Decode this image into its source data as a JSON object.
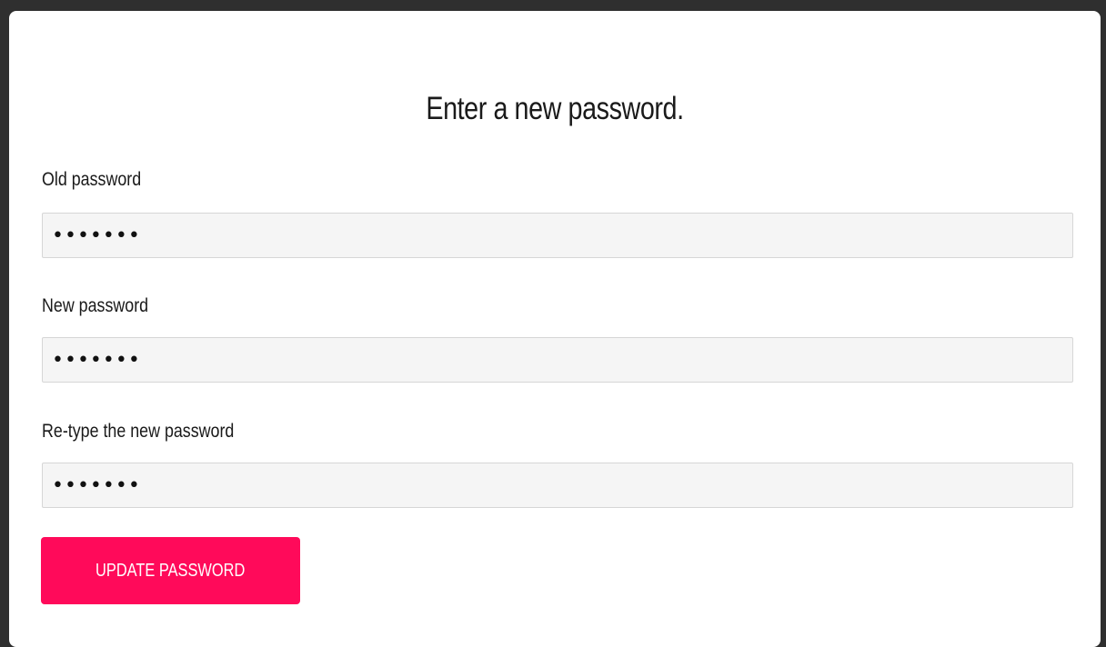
{
  "form": {
    "title": "Enter a new password.",
    "fields": [
      {
        "label": "Old password",
        "value": "•••••••"
      },
      {
        "label": "New password",
        "value": "•••••••"
      },
      {
        "label": "Re-type the new password",
        "value": "•••••••"
      }
    ],
    "submit_label": "UPDATE PASSWORD"
  },
  "colors": {
    "accent": "#ff0a5a",
    "input_background": "#f5f5f5",
    "background": "#2f2f2f"
  }
}
